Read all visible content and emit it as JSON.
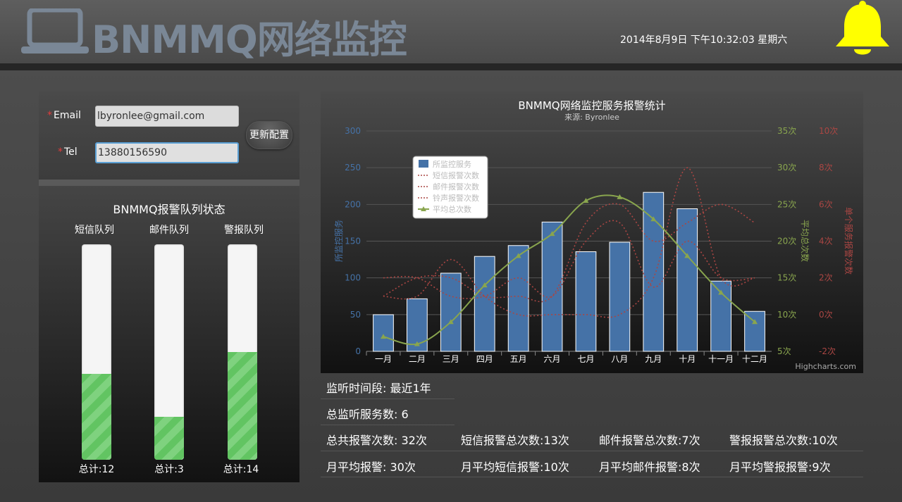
{
  "header": {
    "title": "BNMMQ网络监控",
    "datetime": "2014年8月9日 下午10:32:03 星期六",
    "icons": {
      "laptop": "laptop-icon",
      "bell": "bell-icon"
    },
    "accent": "#7a8796",
    "bell_color": "#ffff00"
  },
  "config": {
    "email_label": "Email",
    "tel_label": "Tel",
    "required_mark": "*",
    "email_value": "lbyronlee@gmail.com",
    "tel_value": "13880156590",
    "update_button": "更新配置"
  },
  "queues": {
    "title": "BNMMQ报警队列状态",
    "items": [
      {
        "label": "短信队列",
        "total": "总计:12",
        "level": 0.4
      },
      {
        "label": "邮件队列",
        "total": "总计:3",
        "level": 0.2
      },
      {
        "label": "警报队列",
        "total": "总计:14",
        "level": 0.5
      }
    ],
    "fill_color": "#62c462"
  },
  "chart_data": {
    "type": "bar",
    "title": "BNMMQ网络监控服务报警统计",
    "subtitle": "来源: Byronlee",
    "credits": "Highcharts.com",
    "categories": [
      "一月",
      "二月",
      "三月",
      "四月",
      "五月",
      "六月",
      "七月",
      "八月",
      "九月",
      "十月",
      "十一月",
      "十二月"
    ],
    "axes": {
      "left": {
        "label": "所监控服务",
        "range": [
          0,
          300
        ],
        "ticks": [
          "0",
          "50",
          "100",
          "150",
          "200",
          "250",
          "300"
        ],
        "color": "#4572a7"
      },
      "right_green": {
        "label": "平均总次数",
        "range": [
          5,
          35
        ],
        "ticks": [
          "5次",
          "10次",
          "15次",
          "20次",
          "25次",
          "30次",
          "35次"
        ],
        "color": "#89a54e"
      },
      "right_red": {
        "label": "单个服务报警次数",
        "range": [
          -2,
          10
        ],
        "ticks": [
          "-2次",
          "0次",
          "2次",
          "4次",
          "6次",
          "8次",
          "10次"
        ],
        "color": "#aa4643"
      }
    },
    "series": [
      {
        "name": "所监控服务",
        "type": "column",
        "axis": "left",
        "color": "#4572a7",
        "values": [
          49.9,
          71.5,
          106.4,
          129.2,
          144.0,
          176.0,
          135.6,
          148.5,
          216.4,
          194.1,
          95.6,
          54.4
        ]
      },
      {
        "name": "短信报警次数",
        "type": "spline-dotted",
        "axis": "right_red",
        "color": "#aa4643",
        "values": [
          2,
          2,
          1,
          1,
          2,
          1,
          4,
          5,
          1.5,
          4,
          2,
          2
        ]
      },
      {
        "name": "邮件报警次数",
        "type": "spline-dotted",
        "axis": "right_red",
        "color": "#aa4643",
        "values": [
          1,
          1,
          3,
          1,
          0,
          0,
          0,
          0,
          2,
          8,
          2,
          2
        ]
      },
      {
        "name": "铃声报警次数",
        "type": "spline-dotted",
        "axis": "right_red",
        "color": "#aa4643",
        "values": [
          1,
          2,
          2,
          1,
          1,
          1,
          5,
          6,
          4,
          5,
          6,
          5
        ]
      },
      {
        "name": "平均总次数",
        "type": "spline",
        "axis": "right_green",
        "color": "#89a54e",
        "values": [
          7.0,
          6.0,
          9.0,
          14.0,
          18.0,
          21.0,
          25.5,
          26.0,
          23.0,
          18.0,
          13.0,
          9.0
        ]
      }
    ],
    "legend_position": "top-left inside"
  },
  "stats": {
    "row1": [
      "监听时间段: 最近1年"
    ],
    "row2": [
      "总监听服务数: 6"
    ],
    "row3": [
      "总共报警次数: 32次",
      "短信报警总次数:13次",
      "邮件报警总次数:7次",
      "警报报警总次数:10次"
    ],
    "row4": [
      "月平均报警: 30次",
      "月平均短信报警:10次",
      "月平均邮件报警:8次",
      "月平均警报报警:9次"
    ]
  }
}
